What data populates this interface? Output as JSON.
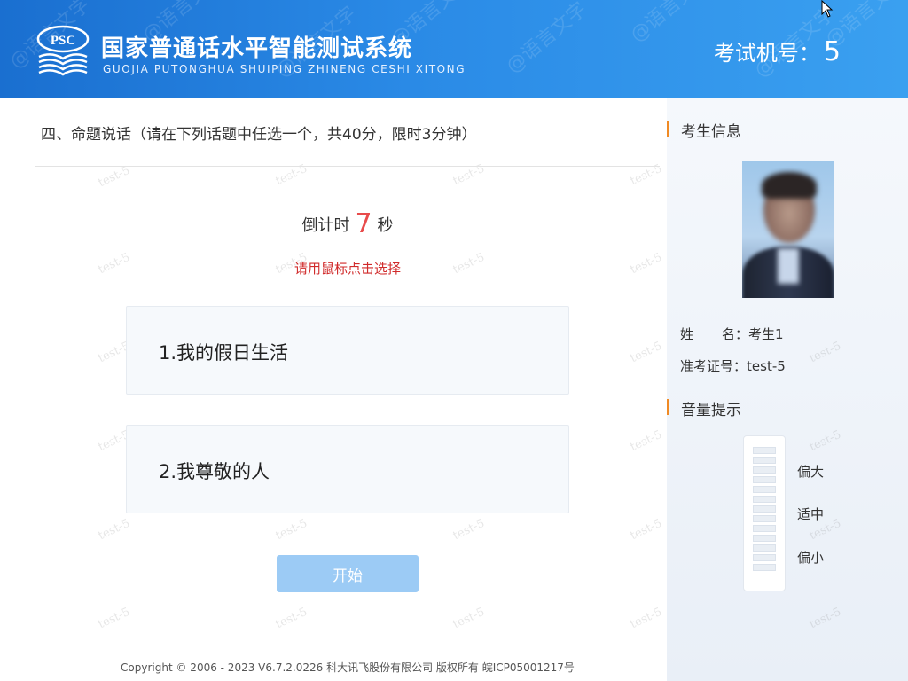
{
  "header": {
    "logo_text": "PSC",
    "title_cn": "国家普通话水平智能测试系统",
    "title_en": "GUOJIA PUTONGHUA SHUIPING ZHINENG CESHI XITONG",
    "exam_no_label": "考试机号：",
    "exam_no_value": "5",
    "watermark": "@语言文字"
  },
  "main": {
    "section_title": "四、命题说话（请在下列话题中任选一个，共40分，限时3分钟）",
    "countdown_prefix": "倒计时",
    "countdown_value": "7",
    "countdown_suffix": "秒",
    "hint": "请用鼠标点击选择",
    "topics": [
      {
        "label": "1.我的假日生活"
      },
      {
        "label": "2.我尊敬的人"
      }
    ],
    "start_label": "开始",
    "watermark": "test-5",
    "copyright": "Copyright © 2006 - 2023 V6.7.2.0226 科大讯飞股份有限公司 版权所有 皖ICP05001217号"
  },
  "sidebar": {
    "info_heading": "考生信息",
    "name_label": "姓名",
    "name_value": "：考生1",
    "id_label": "准考证号",
    "id_value": "：test-5",
    "volume_heading": "音量提示",
    "volume_high": "偏大",
    "volume_mid": "适中",
    "volume_low": "偏小",
    "volume_level": 0
  },
  "colors": {
    "header_blue": "#1a6fd0",
    "countdown_red": "#e84b4b",
    "hint_red": "#d02a2a",
    "button_blue": "#9ccbf5",
    "accent_orange": "#f08a24"
  }
}
